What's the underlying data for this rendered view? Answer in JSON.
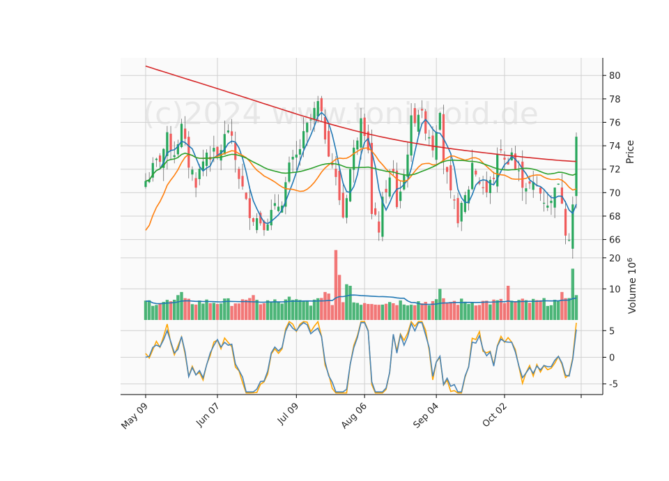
{
  "chart_data": {
    "type": "candlestick",
    "watermark": "(c)2024 www.tonidroid.de",
    "x_tick_labels": [
      "May 09",
      "Jun 07",
      "Jul 09",
      "Aug 06",
      "Sep 04",
      "Oct 02"
    ],
    "x_tick_indices": [
      0,
      20,
      42,
      61,
      81,
      100
    ],
    "n_bars": 121,
    "price_panel": {
      "ylabel": "Price",
      "ylim": [
        65.5,
        81.5
      ],
      "yticks": [
        66,
        68,
        70,
        72,
        74,
        76,
        78,
        80
      ],
      "anchors": [
        [
          0,
          71.0
        ],
        [
          4,
          73.0
        ],
        [
          6,
          74.5
        ],
        [
          8,
          73.5
        ],
        [
          10,
          75.5
        ],
        [
          12,
          72.5
        ],
        [
          14,
          71.0
        ],
        [
          17,
          73.5
        ],
        [
          20,
          73.0
        ],
        [
          23,
          75.5
        ],
        [
          26,
          71.5
        ],
        [
          28,
          69.0
        ],
        [
          30,
          68.0
        ],
        [
          33,
          67.5
        ],
        [
          36,
          68.5
        ],
        [
          38,
          69.5
        ],
        [
          40,
          72.0
        ],
        [
          42,
          73.0
        ],
        [
          45,
          75.5
        ],
        [
          48,
          77.5
        ],
        [
          50,
          75.0
        ],
        [
          52,
          72.5
        ],
        [
          53,
          71.0
        ],
        [
          55,
          68.0
        ],
        [
          56,
          70.0
        ],
        [
          57,
          72.0
        ],
        [
          59,
          75.0
        ],
        [
          60,
          77.0
        ],
        [
          62,
          74.0
        ],
        [
          63,
          68.0
        ],
        [
          65,
          67.0
        ],
        [
          66,
          69.0
        ],
        [
          67,
          70.5
        ],
        [
          69,
          71.5
        ],
        [
          70,
          69.0
        ],
        [
          72,
          71.5
        ],
        [
          74,
          76.0
        ],
        [
          76,
          77.0
        ],
        [
          79,
          75.0
        ],
        [
          80,
          74.0
        ],
        [
          82,
          77.5
        ],
        [
          83,
          73.0
        ],
        [
          85,
          69.5
        ],
        [
          87,
          68.0
        ],
        [
          88,
          68.5
        ],
        [
          90,
          70.5
        ],
        [
          91,
          72.5
        ],
        [
          93,
          71.0
        ],
        [
          95,
          70.0
        ],
        [
          97,
          71.5
        ],
        [
          99,
          74.0
        ],
        [
          100,
          72.5
        ],
        [
          102,
          73.5
        ],
        [
          103,
          72.0
        ],
        [
          105,
          71.0
        ],
        [
          107,
          70.5
        ],
        [
          109,
          70.5
        ],
        [
          111,
          69.5
        ],
        [
          113,
          69.0
        ],
        [
          114,
          71.0
        ],
        [
          116,
          69.5
        ],
        [
          117,
          67.0
        ],
        [
          118,
          66.5
        ],
        [
          119,
          69.0
        ],
        [
          120,
          74.5
        ]
      ],
      "amplitude_seed": 7,
      "moving_averages": [
        {
          "window": 5,
          "color": "#1f77b4"
        },
        {
          "window": 20,
          "color": "#ff7f0e"
        },
        {
          "window": 50,
          "color": "#2ca02c"
        },
        {
          "window": 200,
          "color": "#d62728",
          "start": 80.8,
          "end": 72.6
        }
      ],
      "up_color": "#26a65b",
      "down_color": "#f05a5a"
    },
    "volume_panel": {
      "ylabel": "Volume  10^6",
      "ylim": [
        0,
        24
      ],
      "yticks": [
        10,
        20
      ],
      "spikes": [
        [
          53,
          22.5
        ],
        [
          54,
          14.5
        ],
        [
          56,
          11.5
        ],
        [
          57,
          11.0
        ],
        [
          101,
          11.0
        ],
        [
          82,
          10.0
        ],
        [
          116,
          9.0
        ],
        [
          119,
          16.5
        ],
        [
          120,
          8.0
        ],
        [
          114,
          6.5
        ],
        [
          117,
          7.0
        ],
        [
          50,
          9.0
        ],
        [
          51,
          8.5
        ],
        [
          48,
          7.0
        ],
        [
          40,
          7.5
        ],
        [
          30,
          8.0
        ],
        [
          28,
          6.5
        ],
        [
          10,
          9.0
        ],
        [
          9,
          8.0
        ]
      ],
      "base_volume": 4.5,
      "ma_color": "#1f77b4"
    },
    "oscillator_panel": {
      "ylim": [
        -7.0,
        7.0
      ],
      "yticks": [
        -5,
        0,
        5
      ],
      "line1_color": "#4682b4",
      "line2_color": "#ffa500"
    },
    "colors": {
      "panel_bg": "#fafafa",
      "grid": "#d0d0d0",
      "axis": "#000000"
    }
  }
}
